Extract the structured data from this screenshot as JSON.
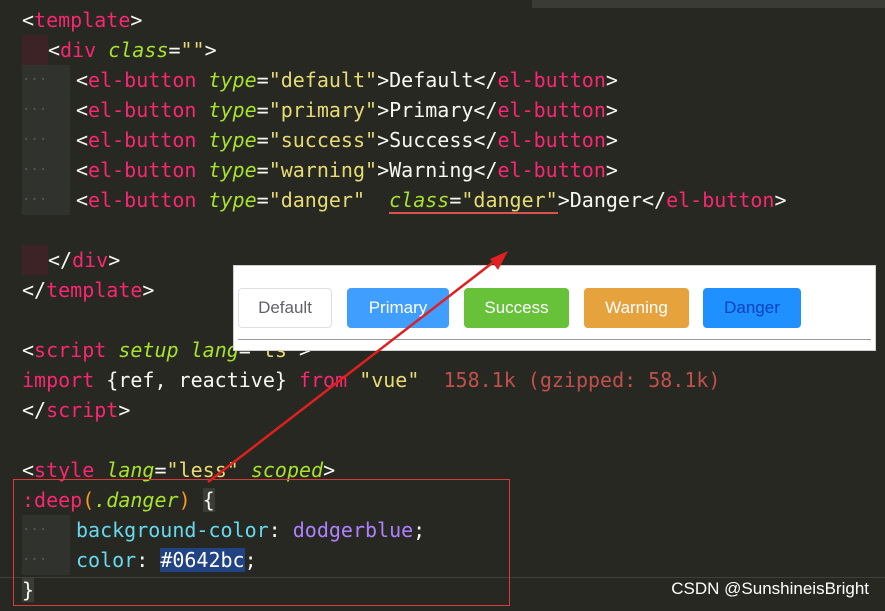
{
  "code": {
    "l1": {
      "open": "<",
      "tag": "template",
      "close": ">"
    },
    "l2": {
      "open": "<",
      "tag": "div",
      "attr": "class",
      "eq": "=",
      "val": "\"\"",
      "close": ">"
    },
    "l3": {
      "open": "<",
      "tag": "el-button",
      "attr": "type",
      "eq": "=",
      "val": "\"default\"",
      "gt": ">",
      "text": "Default",
      "endopen": "</",
      "endtag": "el-button",
      "endclose": ">"
    },
    "l4": {
      "open": "<",
      "tag": "el-button",
      "attr": "type",
      "eq": "=",
      "val": "\"primary\"",
      "gt": ">",
      "text": "Primary",
      "endopen": "</",
      "endtag": "el-button",
      "endclose": ">"
    },
    "l5": {
      "open": "<",
      "tag": "el-button",
      "attr": "type",
      "eq": "=",
      "val": "\"success\"",
      "gt": ">",
      "text": "Success",
      "endopen": "</",
      "endtag": "el-button",
      "endclose": ">"
    },
    "l6": {
      "open": "<",
      "tag": "el-button",
      "attr": "type",
      "eq": "=",
      "val": "\"warning\"",
      "gt": ">",
      "text": "Warning",
      "endopen": "</",
      "endtag": "el-button",
      "endclose": ">"
    },
    "l7": {
      "open": "<",
      "tag": "el-button",
      "attr": "type",
      "eq": "=",
      "val": "\"danger\"",
      "attr2": "class",
      "eq2": "=",
      "val2": "\"danger\"",
      "gt": ">",
      "text": "Danger",
      "endopen": "</",
      "endtag": "el-button",
      "endclose": ">"
    },
    "l9": {
      "open": "</",
      "tag": "div",
      "close": ">"
    },
    "l10": {
      "open": "</",
      "tag": "template",
      "close": ">"
    },
    "l12": {
      "open": "<",
      "tag": "script",
      "attr": "setup",
      "attr2": "lang",
      "eq": "=",
      "val": "\"ts\"",
      "close": ">"
    },
    "l13": {
      "kw": "import",
      "names": "{ref, reactive}",
      "from": "from",
      "src": "\"vue\"",
      "hint": "158.1k (gzipped: 58.1k)"
    },
    "l14": {
      "open": "</",
      "tag": "script",
      "close": ">"
    },
    "l16": {
      "open": "<",
      "tag": "style",
      "attr": "lang",
      "eq": "=",
      "val": "\"less\"",
      "attr2": "scoped",
      "close": ">"
    },
    "l17": {
      "pre": ":deep",
      "paren_open": "(",
      "sel": ".danger",
      "paren_close": ")",
      "brace": "{"
    },
    "l18": {
      "prop": "background-color",
      "colon": ":",
      "value": "dodgerblue",
      "semi": ";"
    },
    "l19": {
      "prop": "color",
      "colon": ":",
      "value": "#0642bc",
      "semi": ";"
    },
    "l20": {
      "brace": "}"
    }
  },
  "preview": {
    "buttons": [
      {
        "label": "Default",
        "bg": "#ffffff",
        "border": "#dcdfe6",
        "color": "#606266"
      },
      {
        "label": "Primary",
        "bg": "#409eff",
        "border": "#409eff",
        "color": "#ffffff"
      },
      {
        "label": "Success",
        "bg": "#67c23a",
        "border": "#67c23a",
        "color": "#ffffff"
      },
      {
        "label": "Warning",
        "bg": "#e6a23c",
        "border": "#e6a23c",
        "color": "#ffffff"
      },
      {
        "label": "Danger",
        "bg": "#1e90ff",
        "border": "#1e90ff",
        "color": "#0642bc"
      }
    ]
  },
  "watermark": "CSDN @SunshineisBright",
  "colors": {
    "editor_bg": "#272822",
    "highlight_box": "#d93a3a",
    "arrow": "#e02020"
  }
}
